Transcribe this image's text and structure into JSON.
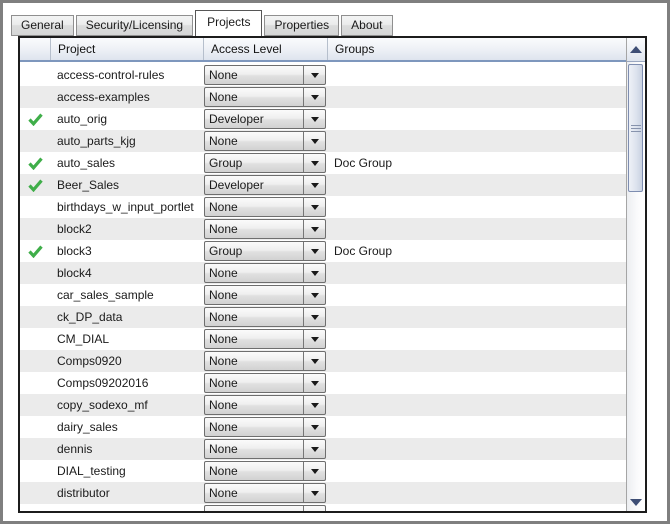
{
  "tabs": [
    {
      "label": "General",
      "active": false
    },
    {
      "label": "Security/Licensing",
      "active": false
    },
    {
      "label": "Projects",
      "active": true
    },
    {
      "label": "Properties",
      "active": false
    },
    {
      "label": "About",
      "active": false
    }
  ],
  "table": {
    "columns": [
      "Project",
      "Access Level",
      "Groups"
    ],
    "access_level_control": "dropdown",
    "rows": [
      {
        "checked": false,
        "project": "access-control-rules",
        "access_level": "None",
        "groups": ""
      },
      {
        "checked": false,
        "project": "access-examples",
        "access_level": "None",
        "groups": ""
      },
      {
        "checked": true,
        "project": "auto_orig",
        "access_level": "Developer",
        "groups": ""
      },
      {
        "checked": false,
        "project": "auto_parts_kjg",
        "access_level": "None",
        "groups": ""
      },
      {
        "checked": true,
        "project": "auto_sales",
        "access_level": "Group",
        "groups": "Doc Group"
      },
      {
        "checked": true,
        "project": "Beer_Sales",
        "access_level": "Developer",
        "groups": ""
      },
      {
        "checked": false,
        "project": "birthdays_w_input_portlet",
        "access_level": "None",
        "groups": ""
      },
      {
        "checked": false,
        "project": "block2",
        "access_level": "None",
        "groups": ""
      },
      {
        "checked": true,
        "project": "block3",
        "access_level": "Group",
        "groups": "Doc Group"
      },
      {
        "checked": false,
        "project": "block4",
        "access_level": "None",
        "groups": ""
      },
      {
        "checked": false,
        "project": "car_sales_sample",
        "access_level": "None",
        "groups": ""
      },
      {
        "checked": false,
        "project": "ck_DP_data",
        "access_level": "None",
        "groups": ""
      },
      {
        "checked": false,
        "project": "CM_DIAL",
        "access_level": "None",
        "groups": ""
      },
      {
        "checked": false,
        "project": "Comps0920",
        "access_level": "None",
        "groups": ""
      },
      {
        "checked": false,
        "project": "Comps09202016",
        "access_level": "None",
        "groups": ""
      },
      {
        "checked": false,
        "project": "copy_sodexo_mf",
        "access_level": "None",
        "groups": ""
      },
      {
        "checked": false,
        "project": "dairy_sales",
        "access_level": "None",
        "groups": ""
      },
      {
        "checked": false,
        "project": "dennis",
        "access_level": "None",
        "groups": ""
      },
      {
        "checked": false,
        "project": "DIAL_testing",
        "access_level": "None",
        "groups": ""
      },
      {
        "checked": false,
        "project": "distributor",
        "access_level": "None",
        "groups": ""
      }
    ],
    "partial_row_visible": true
  },
  "scrollbar": {
    "orientation": "vertical",
    "thumb_position": "near-top"
  },
  "colors": {
    "check_green": "#3fae49",
    "header_bottom_border": "#7e97bd",
    "zebra_stripe": "#ebebeb",
    "scroll_arrow": "#3e4e75",
    "table_border": "#1c1c1c"
  }
}
